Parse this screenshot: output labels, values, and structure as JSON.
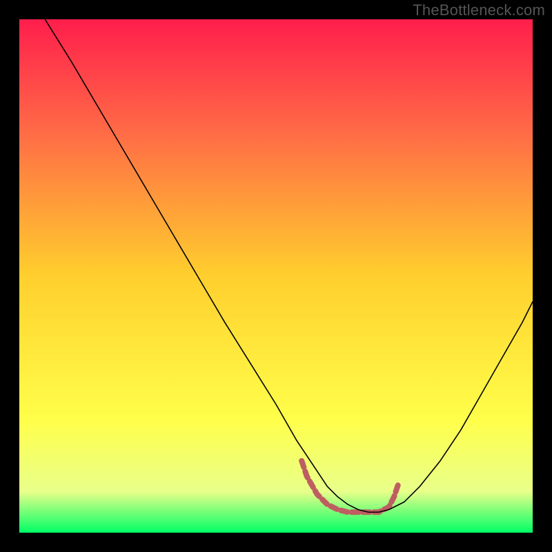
{
  "watermark": "TheBottleneck.com",
  "chart_data": {
    "type": "line",
    "title": "",
    "xlabel": "",
    "ylabel": "",
    "xlim": [
      0,
      100
    ],
    "ylim": [
      0,
      100
    ],
    "background_gradient": {
      "top": "#ff1e4c",
      "upper_mid": "#ff6b46",
      "mid": "#ffcf2d",
      "lower_mid": "#ffff4a",
      "lowest": "#e8ff8a",
      "bottom": "#00ff66"
    },
    "series": [
      {
        "name": "curve",
        "color": "#000000",
        "stroke_width": 1.6,
        "x": [
          5,
          10,
          15,
          20,
          25,
          30,
          35,
          40,
          45,
          50,
          54,
          58,
          60,
          62,
          64,
          66,
          68,
          70,
          72,
          75,
          78,
          82,
          86,
          90,
          94,
          98,
          100
        ],
        "values": [
          100,
          92,
          83.5,
          75,
          66.5,
          58,
          49.5,
          41,
          33,
          25,
          18,
          12,
          9,
          7,
          5.5,
          4.5,
          4,
          4,
          4.5,
          6,
          9,
          14,
          20,
          27,
          34,
          41,
          45
        ]
      }
    ],
    "marker_band": {
      "name": "optimum-band",
      "color": "#be5e61",
      "stroke_width": 8,
      "x": [
        55,
        56,
        58,
        60,
        62,
        64,
        66,
        68,
        70,
        72,
        73,
        74
      ],
      "values": [
        14,
        11,
        7.5,
        5.5,
        4.5,
        4,
        4,
        4,
        4,
        5,
        7,
        10
      ]
    }
  }
}
